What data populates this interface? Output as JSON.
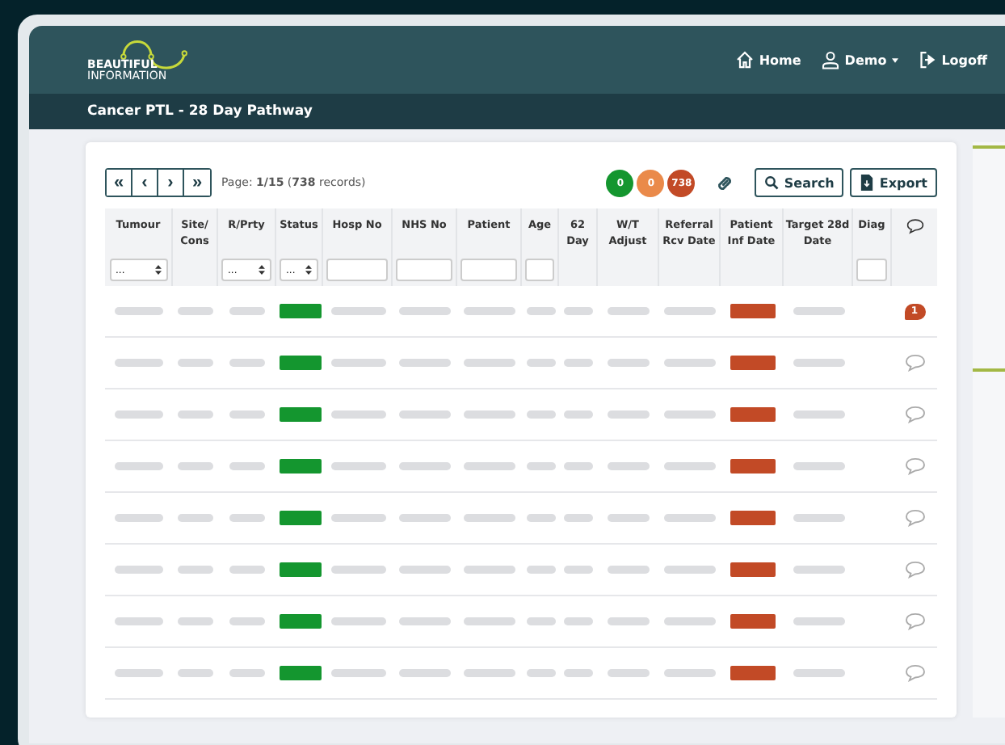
{
  "header": {
    "logo_line_1": "BEAUTIFUL",
    "logo_line_2": "INFORMATION",
    "nav": [
      {
        "label": "Home",
        "kind": "home"
      },
      {
        "label": "Demo",
        "kind": "user"
      },
      {
        "label": "Logoff",
        "kind": "logoff"
      }
    ]
  },
  "page_title": "Cancer PTL - 28 Day Pathway",
  "toolbar": {
    "pager": [
      "«",
      "‹",
      "›",
      "»"
    ],
    "page_info": "Page: **1/15** (**738** records)",
    "counts": [
      {
        "value": "0",
        "color": "#14962f"
      },
      {
        "value": "0",
        "color": "#ea8a4a"
      },
      {
        "value": "738",
        "color": "#c24a26"
      }
    ],
    "buttons": [
      {
        "label": "Search",
        "kind": "search"
      },
      {
        "label": "Export",
        "kind": "export"
      }
    ]
  },
  "table": {
    "columns": [
      {
        "label": "Tumour",
        "filter": {
          "kind": "select",
          "value": "..."
        }
      },
      {
        "label": "Site/ Cons"
      },
      {
        "label": "R/Prty",
        "filter": {
          "kind": "select",
          "value": "..."
        }
      },
      {
        "label": "Status",
        "filter": {
          "kind": "select",
          "value": "..."
        }
      },
      {
        "label": "Hosp No",
        "filter": {
          "kind": "input"
        }
      },
      {
        "label": "NHS No",
        "filter": {
          "kind": "input"
        }
      },
      {
        "label": "Patient",
        "filter": {
          "kind": "input"
        }
      },
      {
        "label": "Age",
        "filter": {
          "kind": "input"
        }
      },
      {
        "label": "62 Day"
      },
      {
        "label": "W/T Adjust"
      },
      {
        "label": "Referral Rcv Date"
      },
      {
        "label": "Patient Inf Date"
      },
      {
        "label": "Target 28d Date"
      },
      {
        "label": "Diag",
        "filter": {
          "kind": "input"
        }
      },
      {
        "kind": "comment"
      }
    ],
    "rows": [
      {
        "status": {
          "color": "#14962f"
        },
        "inf_date": {
          "color": "#c24a26"
        },
        "comments": "1"
      },
      {
        "status": {
          "color": "#14962f"
        },
        "inf_date": {
          "color": "#c24a26"
        }
      },
      {
        "status": {
          "color": "#14962f"
        },
        "inf_date": {
          "color": "#c24a26"
        }
      },
      {
        "status": {
          "color": "#14962f"
        },
        "inf_date": {
          "color": "#c24a26"
        }
      },
      {
        "status": {
          "color": "#14962f"
        },
        "inf_date": {
          "color": "#c24a26"
        }
      },
      {
        "status": {
          "color": "#14962f"
        },
        "inf_date": {
          "color": "#c24a26"
        }
      },
      {
        "status": {
          "color": "#14962f"
        },
        "inf_date": {
          "color": "#c24a26"
        }
      },
      {
        "status": {
          "color": "#14962f"
        },
        "inf_date": {
          "color": "#c24a26"
        }
      }
    ]
  }
}
